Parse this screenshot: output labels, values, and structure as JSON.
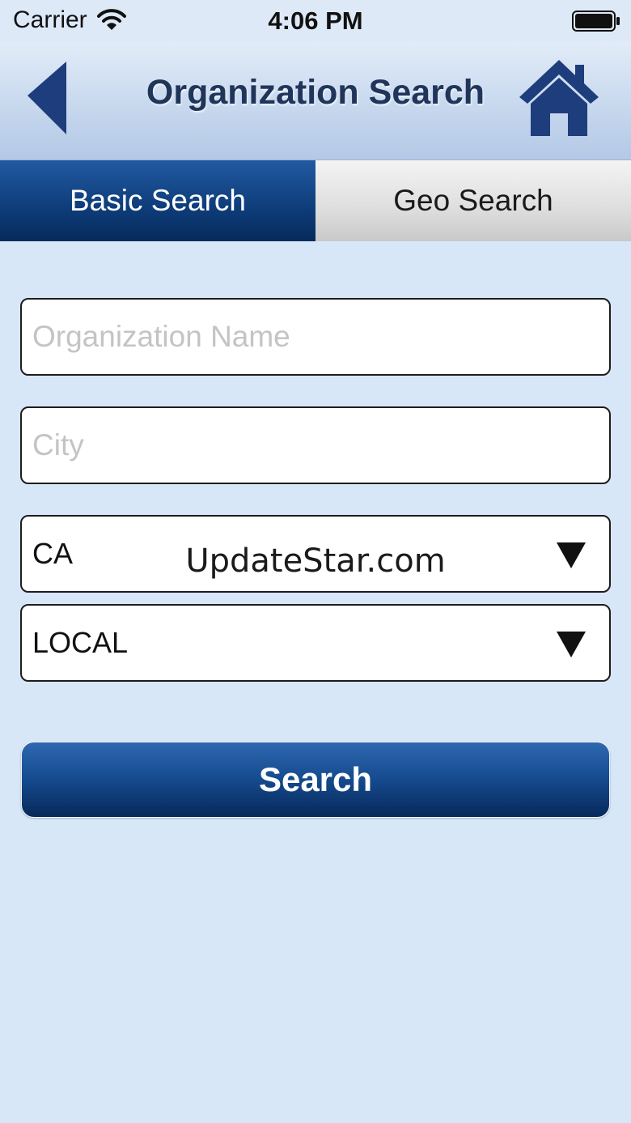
{
  "status_bar": {
    "carrier": "Carrier",
    "time": "4:06 PM"
  },
  "nav": {
    "title": "Organization Search",
    "back_icon": "back-arrow-icon",
    "home_icon": "home-icon"
  },
  "tabs": [
    {
      "label": "Basic Search",
      "selected": true
    },
    {
      "label": "Geo Search",
      "selected": false
    }
  ],
  "form": {
    "organization_name": {
      "placeholder": "Organization Name",
      "value": ""
    },
    "city": {
      "placeholder": "City",
      "value": ""
    },
    "state_select": {
      "value": "CA"
    },
    "scope_select": {
      "value": "LOCAL"
    },
    "search_label": "Search"
  },
  "watermark": "UpdateStar.com",
  "colors": {
    "background": "#d8e7f8",
    "tab_selected": "#0e3c79",
    "tab_unselected": "#dedede",
    "title": "#20355a",
    "accent": "#154a8e"
  }
}
